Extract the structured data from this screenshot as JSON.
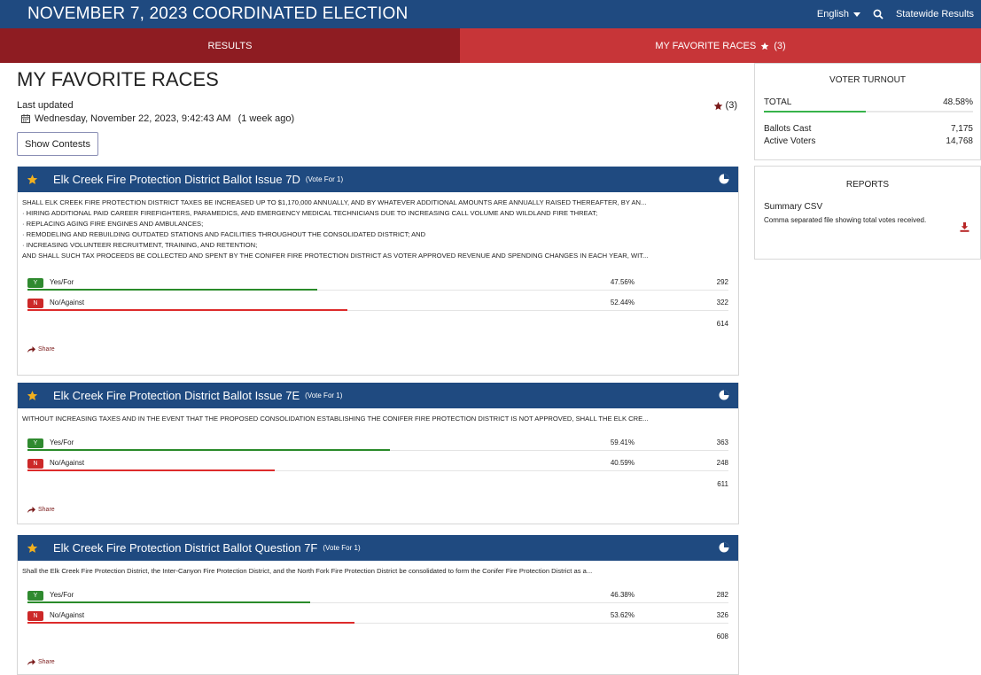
{
  "header": {
    "title": "NOVEMBER 7, 2023 COORDINATED ELECTION",
    "language": "English",
    "statewide_link": "Statewide Results"
  },
  "tabs": {
    "results": "RESULTS",
    "favorites": "MY FAVORITE RACES",
    "favorites_count": "(3)"
  },
  "page": {
    "title": "MY FAVORITE RACES",
    "last_updated_label": "Last updated",
    "last_updated_date": "Wednesday, November 22, 2023, 9:42:43 AM",
    "last_updated_ago": "(1 week ago)",
    "favorites_count": "(3)",
    "show_contests_label": "Show Contests"
  },
  "races": [
    {
      "title": "Elk Creek Fire Protection District Ballot Issue 7D",
      "vote_for": "(Vote For 1)",
      "text_lines": [
        "SHALL ELK CREEK FIRE PROTECTION DISTRICT TAXES BE INCREASED UP TO $1,170,000 ANNUALLY, AND BY WHATEVER ADDITIONAL AMOUNTS ARE ANNUALLY RAISED THEREAFTER, BY AN...",
        "· HIRING ADDITIONAL PAID CAREER FIREFIGHTERS, PARAMEDICS, AND EMERGENCY MEDICAL TECHNICIANS DUE TO INCREASING CALL VOLUME AND WILDLAND FIRE THREAT;",
        "· REPLACING AGING FIRE ENGINES AND AMBULANCES;",
        "· REMODELING AND REBUILDING OUTDATED STATIONS AND FACILITIES THROUGHOUT THE CONSOLIDATED DISTRICT; AND",
        "· INCREASING VOLUNTEER RECRUITMENT, TRAINING, AND RETENTION;",
        "AND SHALL SUCH TAX PROCEEDS BE COLLECTED AND SPENT BY THE CONIFER FIRE PROTECTION DISTRICT AS VOTER APPROVED REVENUE AND SPENDING CHANGES IN EACH YEAR, WIT..."
      ],
      "choices": [
        {
          "badge": "Y",
          "name": "Yes/For",
          "pct": "47.56%",
          "votes": "292",
          "pct_value": 47.56
        },
        {
          "badge": "N",
          "name": "No/Against",
          "pct": "52.44%",
          "votes": "322",
          "pct_value": 52.44
        }
      ],
      "total": "614",
      "share": "Share"
    },
    {
      "title": "Elk Creek Fire Protection District Ballot Issue 7E",
      "vote_for": "(Vote For 1)",
      "text_lines": [
        "WITHOUT INCREASING TAXES AND IN THE EVENT THAT THE PROPOSED CONSOLIDATION ESTABLISHING THE CONIFER FIRE PROTECTION DISTRICT IS NOT APPROVED, SHALL THE ELK CRE..."
      ],
      "choices": [
        {
          "badge": "Y",
          "name": "Yes/For",
          "pct": "59.41%",
          "votes": "363",
          "pct_value": 59.41
        },
        {
          "badge": "N",
          "name": "No/Against",
          "pct": "40.59%",
          "votes": "248",
          "pct_value": 40.59
        }
      ],
      "total": "611",
      "share": "Share"
    },
    {
      "title": "Elk Creek Fire Protection District Ballot Question 7F",
      "vote_for": "(Vote For 1)",
      "text_lines": [
        "Shall the Elk Creek Fire Protection District, the Inter-Canyon Fire Protection District, and the North Fork Fire Protection District be consolidated to form the Conifer Fire Protection District as a..."
      ],
      "choices": [
        {
          "badge": "Y",
          "name": "Yes/For",
          "pct": "46.38%",
          "votes": "282",
          "pct_value": 46.38
        },
        {
          "badge": "N",
          "name": "No/Against",
          "pct": "53.62%",
          "votes": "326",
          "pct_value": 53.62
        }
      ],
      "total": "608",
      "share": "Share"
    }
  ],
  "turnout": {
    "heading": "VOTER TURNOUT",
    "total_label": "TOTAL",
    "total_pct": "48.58%",
    "total_pct_value": 48.58,
    "ballots_cast_label": "Ballots Cast",
    "ballots_cast": "7,175",
    "active_voters_label": "Active Voters",
    "active_voters": "14,768"
  },
  "reports": {
    "heading": "REPORTS",
    "item_title": "Summary CSV",
    "item_desc": "Comma separated file showing total votes received."
  },
  "colors": {
    "header_blue": "#1f4a80",
    "tab_dark_red": "#8e1c22",
    "tab_red": "#c73538",
    "yes_green": "#2a8b2a",
    "no_red": "#dd2b2b",
    "turnout_green": "#37b34a",
    "star_gold": "#f2b01e",
    "star_maroon": "#7a1a1a"
  }
}
